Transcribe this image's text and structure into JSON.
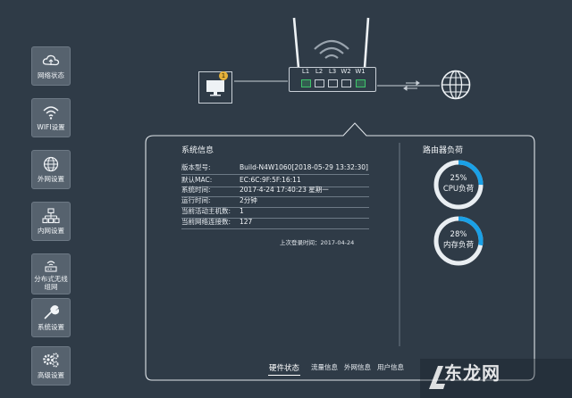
{
  "sidebar": {
    "items": [
      {
        "label": "网络状态",
        "icon": "cloud-icon"
      },
      {
        "label": "WIFI设置",
        "icon": "wifi-icon"
      },
      {
        "label": "外网设置",
        "icon": "globe-icon"
      },
      {
        "label": "内网设置",
        "icon": "network-icon"
      },
      {
        "label": "分布式无线组网",
        "icon": "mesh-router-icon"
      },
      {
        "label": "系统设置",
        "icon": "wrench-icon"
      },
      {
        "label": "高级设置",
        "icon": "gears-icon"
      }
    ]
  },
  "topology": {
    "ports": [
      "L1",
      "L2",
      "L3",
      "W2",
      "W1"
    ],
    "notification_count": "1"
  },
  "system_info": {
    "title": "系统信息",
    "rows": [
      {
        "key": "版本型号:",
        "value": "Build-N4W1060[2018-05-29 13:32:30]"
      },
      {
        "key": "默认MAC:",
        "value": "EC:6C:9F:5F:16:11"
      },
      {
        "key": "系统时间:",
        "value": "2017-4-24 17:40:23 星期一"
      },
      {
        "key": "运行时间:",
        "value": "2分钟"
      },
      {
        "key": "当前活动主机数:",
        "value": "1"
      },
      {
        "key": "当前网络连接数:",
        "value": "127"
      }
    ],
    "last_login": "上次登录时间：2017-04-24"
  },
  "router_load": {
    "title": "路由器负荷",
    "cpu": {
      "percent": 25,
      "percent_label": "25%",
      "label": "CPU负荷"
    },
    "mem": {
      "percent": 28,
      "percent_label": "28%",
      "label": "内存负荷"
    }
  },
  "tabs": [
    {
      "label": "硬件状态",
      "active": true
    },
    {
      "label": "流量信息",
      "active": false
    },
    {
      "label": "外网信息",
      "active": false
    },
    {
      "label": "用户信息",
      "active": false
    }
  ],
  "watermark": {
    "text": "东龙网"
  },
  "colors": {
    "background": "#2f3b47",
    "accent_blue": "#1aa0e6",
    "port_green": "#3fc46b",
    "notification": "#e6b23a"
  }
}
